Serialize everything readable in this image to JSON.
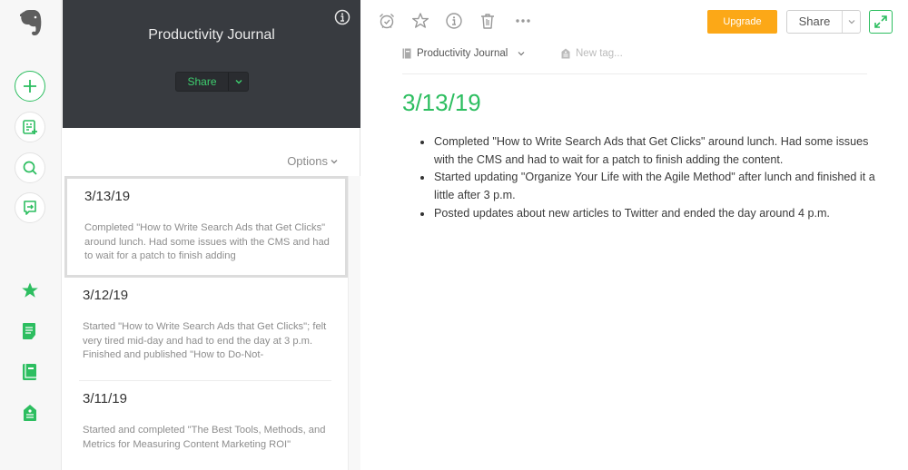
{
  "colors": {
    "accent_green": "#2dbe60",
    "upgrade_orange": "#fca817",
    "notebook_header_bg": "#383b40"
  },
  "rail": {
    "logo": "evernote-elephant-icon",
    "actions": [
      {
        "name": "new-note",
        "icon": "plus-icon"
      },
      {
        "name": "new-from-template",
        "icon": "template-add-icon"
      },
      {
        "name": "search",
        "icon": "search-icon"
      },
      {
        "name": "work-chat",
        "icon": "chat-share-icon"
      }
    ],
    "nav": [
      {
        "name": "shortcuts",
        "icon": "star-icon"
      },
      {
        "name": "notes",
        "icon": "note-icon"
      },
      {
        "name": "notebooks",
        "icon": "notebook-icon"
      },
      {
        "name": "tags",
        "icon": "tag-icon"
      }
    ]
  },
  "notebook": {
    "title": "Productivity Journal",
    "share_label": "Share",
    "options_label": "Options",
    "notes": [
      {
        "date": "3/13/19",
        "snippet": "Completed \"How to Write Search Ads that Get Clicks\" around lunch. Had some issues with the CMS and had to wait for a patch to finish adding",
        "selected": true
      },
      {
        "date": "3/12/19",
        "snippet": "Started \"How to Write Search Ads that Get Clicks\"; felt very tired mid-day and had to end the day at 3 p.m. Finished and published \"How to Do-Not-",
        "selected": false
      },
      {
        "date": "3/11/19",
        "snippet": "Started and completed \"The Best Tools, Methods, and Metrics for Measuring Content Marketing ROI\"",
        "selected": false
      }
    ]
  },
  "editor": {
    "toolbar": {
      "icons": [
        "reminder-icon",
        "star-icon",
        "info-icon",
        "trash-icon",
        "more-icon"
      ],
      "upgrade_label": "Upgrade",
      "share_label": "Share"
    },
    "notebook_name": "Productivity Journal",
    "tag_placeholder": "New tag...",
    "note_title": "3/13/19",
    "bullets": [
      "Completed \"How to Write Search Ads that Get Clicks\" around lunch. Had some issues with the CMS and had to wait for a patch to finish adding the content.",
      "Started updating \"Organize Your Life with the Agile Method\" after lunch and finished it a little after 3 p.m.",
      "Posted updates about new articles to Twitter and ended the day around 4 p.m."
    ]
  }
}
